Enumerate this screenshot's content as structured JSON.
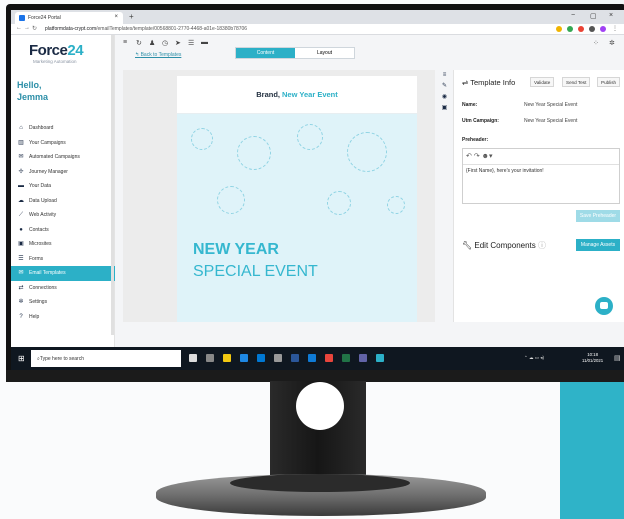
{
  "browser": {
    "tab_title": "Force24 Portal",
    "tab_close": "×",
    "new_tab": "+",
    "url_host": "platformdata-crypt.com",
    "url_path": "/emailTemplates/template/00568801-2770-4468-a01e-18380b78706",
    "window_min": "−",
    "window_max": "▢",
    "window_close": "×"
  },
  "sidebar": {
    "logo_main": "Force",
    "logo_accent": "24",
    "logo_sub": "Marketing Automation",
    "greeting": "Hello,",
    "user": "Jemma",
    "items": [
      {
        "label": "Dashboard",
        "icon": "home-icon",
        "glyph": "⌂"
      },
      {
        "label": "Your Campaigns",
        "icon": "bar-chart-icon",
        "glyph": "▥"
      },
      {
        "label": "Automated Campaigns",
        "icon": "mail-icon",
        "glyph": "✉"
      },
      {
        "label": "Journey Manager",
        "icon": "route-icon",
        "glyph": "✢"
      },
      {
        "label": "Your Data",
        "icon": "folder-icon",
        "glyph": "▬"
      },
      {
        "label": "Data Upload",
        "icon": "cloud-upload-icon",
        "glyph": "☁"
      },
      {
        "label": "Web Activity",
        "icon": "line-chart-icon",
        "glyph": "⟋"
      },
      {
        "label": "Contacts",
        "icon": "person-icon",
        "glyph": "●"
      },
      {
        "label": "Microsites",
        "icon": "microsite-icon",
        "glyph": "▣"
      },
      {
        "label": "Forms",
        "icon": "form-icon",
        "glyph": "☰"
      },
      {
        "label": "Email Templates",
        "icon": "template-icon",
        "glyph": "✉"
      },
      {
        "label": "Connections",
        "icon": "connection-icon",
        "glyph": "⇄"
      },
      {
        "label": "Settings",
        "icon": "gear-icon",
        "glyph": "✲"
      },
      {
        "label": "Help",
        "icon": "help-icon",
        "glyph": "?"
      }
    ],
    "active_index": 10
  },
  "editor": {
    "back_link": "Back to Templates",
    "tab_content": "Content",
    "tab_layout": "Layout",
    "email_brand": "Brand,",
    "email_brand_hl": "New Year Event",
    "email_title_1": "NEW YEAR",
    "email_title_2": "SPECIAL EVENT"
  },
  "panel": {
    "title": "Template Info",
    "validate": "Validate",
    "send_test": "Send Test",
    "publish": "Publish",
    "name_label": "Name:",
    "name_value": "New Year Special Event",
    "utm_label": "Utm Campaign:",
    "utm_value": "New Year Special Event",
    "preheader_label": "Preheader:",
    "preheader_text": "{First Name}, here's your invitation!",
    "save_preheader": "Save Preheader",
    "edit_components": "Edit Components",
    "manage_assets": "Manage Assets"
  },
  "taskbar": {
    "search_placeholder": "Type here to search",
    "time": "10:18",
    "date": "11/01/2021"
  },
  "colors": {
    "accent": "#2cb0c7",
    "brand_dark": "#1a2a44",
    "taskbar": "#0f1720"
  }
}
